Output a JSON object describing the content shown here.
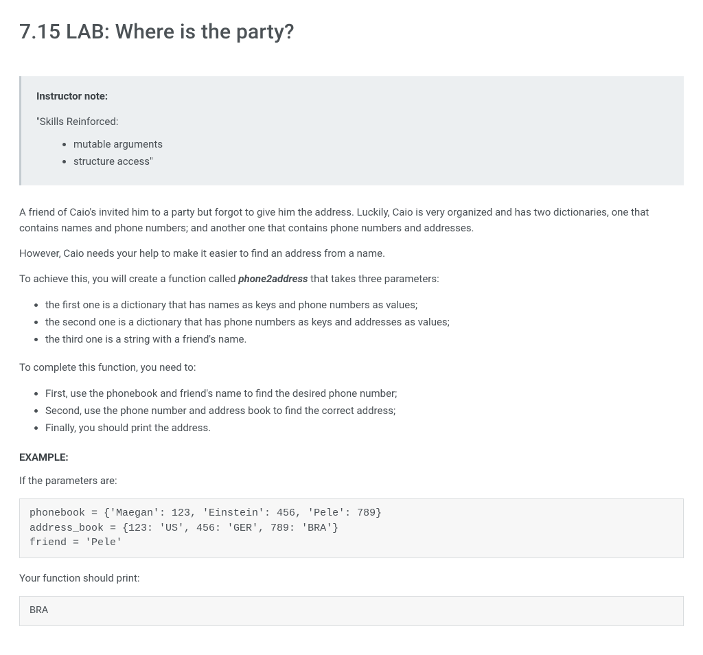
{
  "title": "7.15 LAB: Where is the party?",
  "note": {
    "heading": "Instructor note:",
    "skills_label": "\"Skills Reinforced:",
    "skills": [
      "mutable arguments",
      "structure access\""
    ]
  },
  "para1": "A friend of Caio's invited him to a party but forgot to give him the address. Luckily, Caio is very organized and has two dictionaries, one that contains names and phone numbers; and another one that contains phone numbers and addresses.",
  "para2": "However, Caio needs your help to make it easier to find an address from a name.",
  "para3_pre": "To achieve this, you will create a function called ",
  "fn_name": "phone2address",
  "para3_post": " that takes three parameters:",
  "params": [
    "the first one is a dictionary that has names as keys and phone numbers as values;",
    "the second one is a dictionary that has phone numbers as keys and addresses as values;",
    "the third one is a string with a friend's name."
  ],
  "para4": "To complete this function, you need to:",
  "steps": [
    "First, use the phonebook and friend's name to find the desired phone number;",
    "Second, use the phone number and address book to find the correct address;",
    "Finally, you should print the address."
  ],
  "example_label": "EXAMPLE:",
  "example_intro": "If the parameters are:",
  "code1": "phonebook = {'Maegan': 123, 'Einstein': 456, 'Pele': 789}\naddress_book = {123: 'US', 456: 'GER', 789: 'BRA'}\nfriend = 'Pele'",
  "example_outro": "Your function should print:",
  "code2": "BRA"
}
